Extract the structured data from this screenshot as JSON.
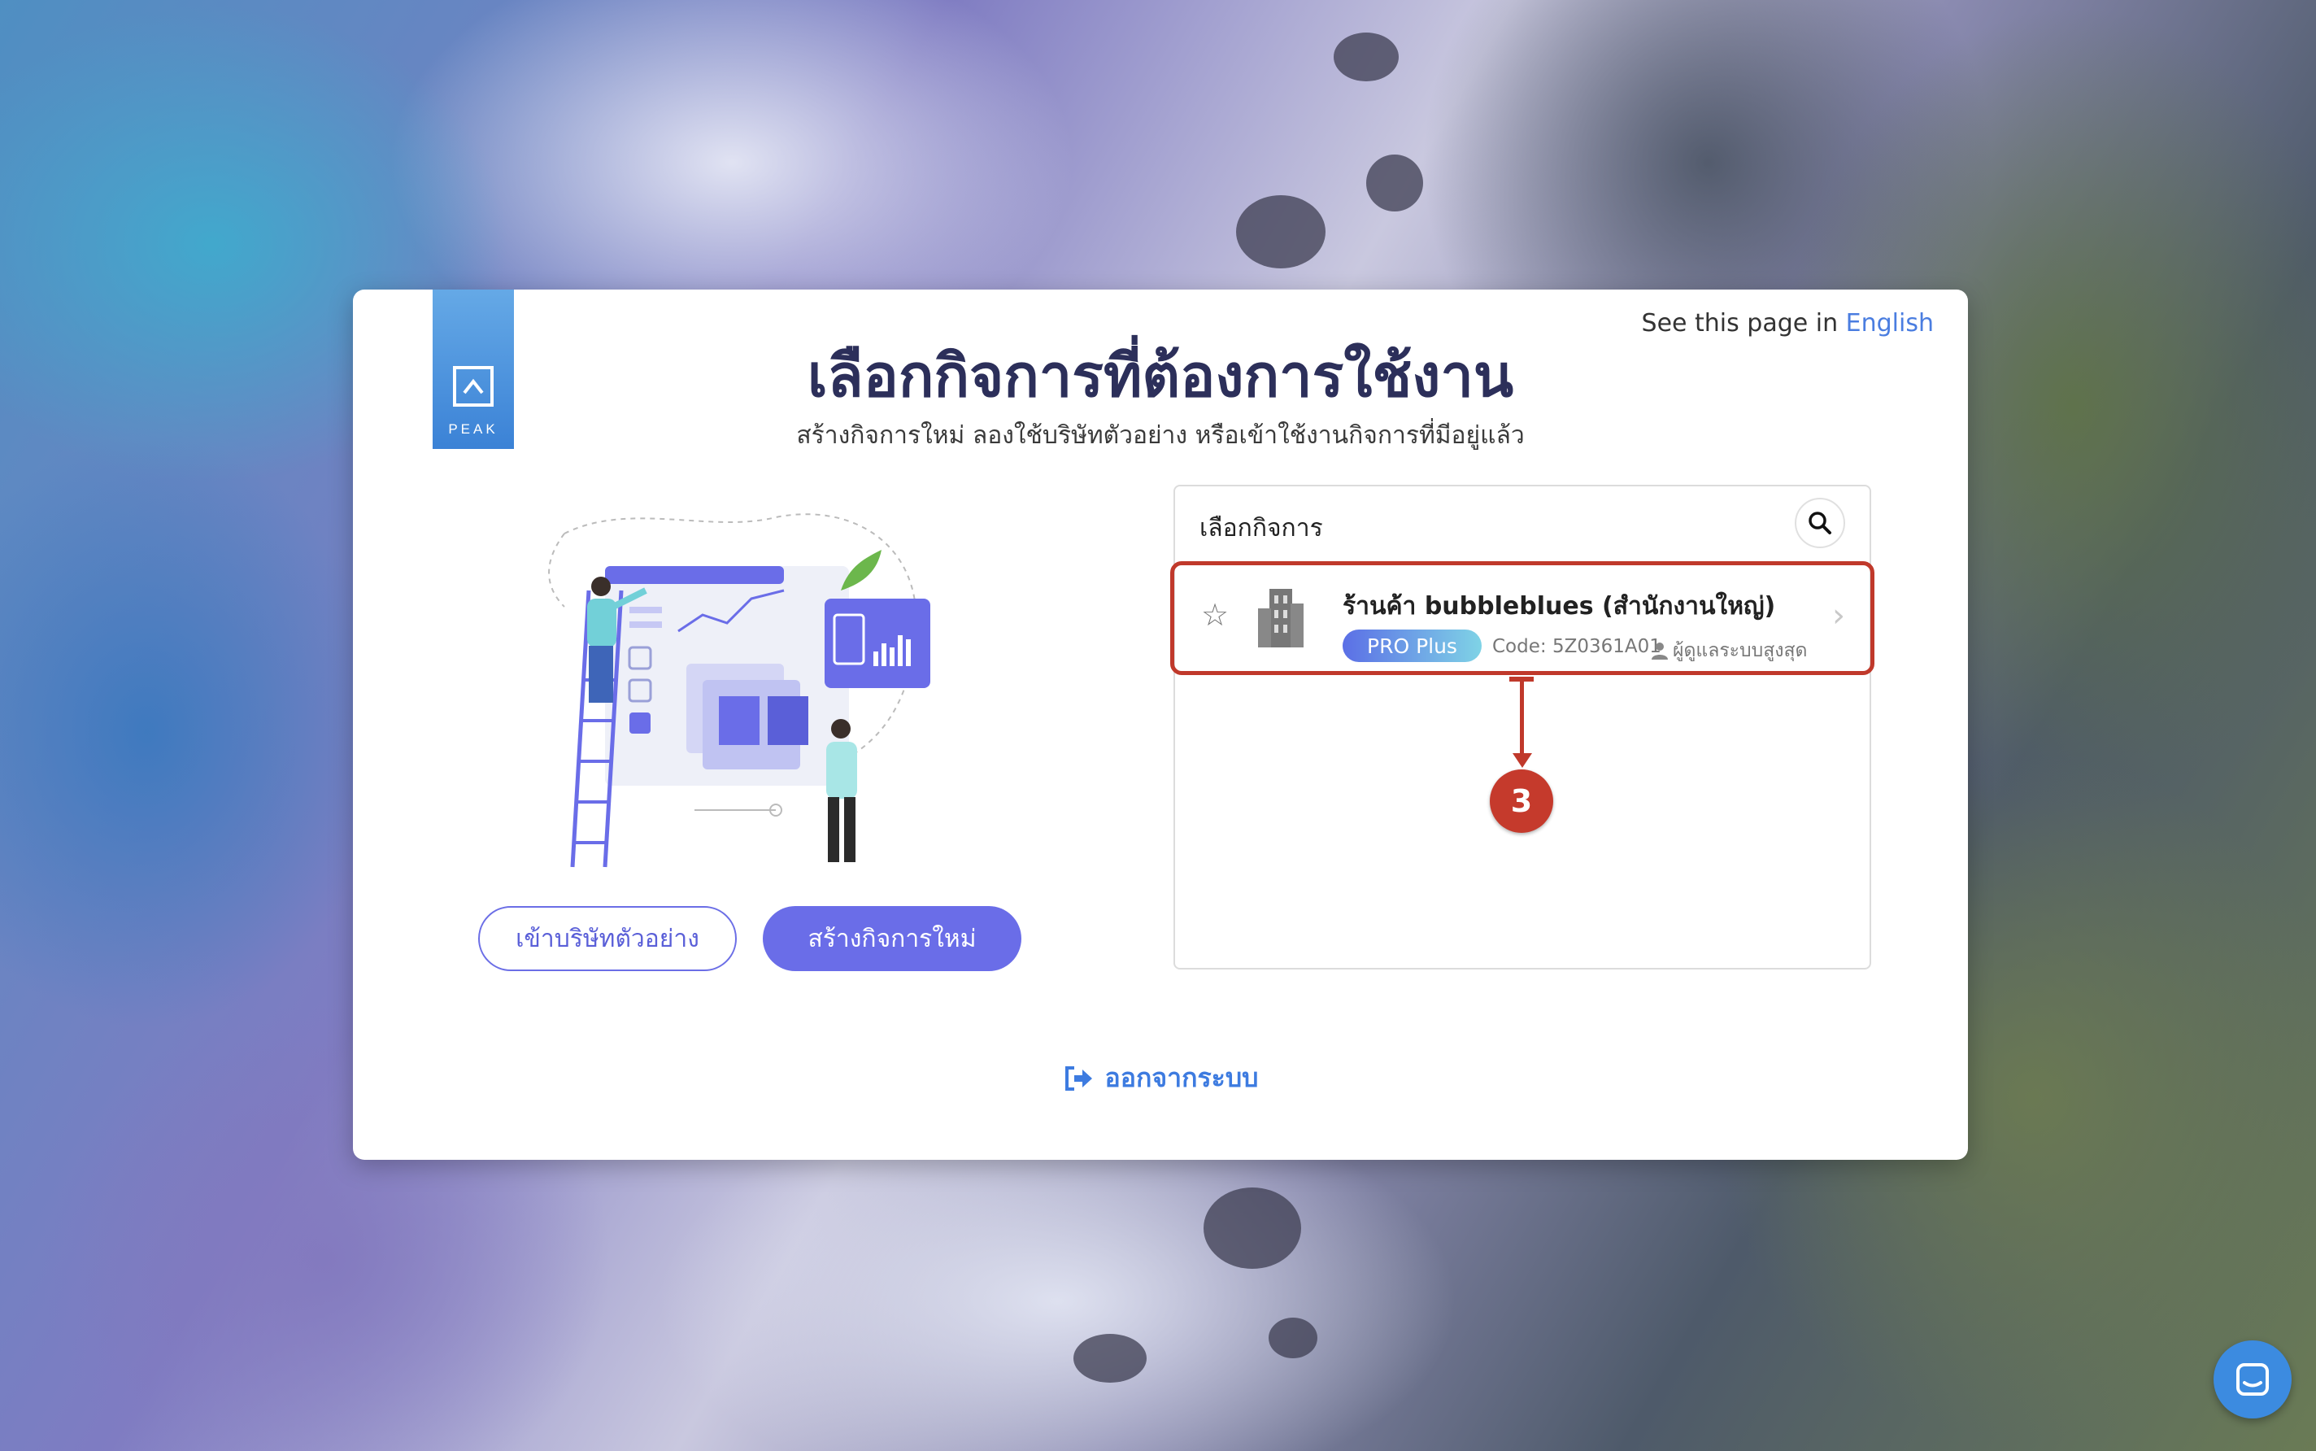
{
  "language": {
    "prefix": "See this page in",
    "link": "English"
  },
  "logo": {
    "text": "PEAK"
  },
  "page": {
    "title": "เลือกกิจการที่ต้องการใช้งาน",
    "subtitle": "สร้างกิจการใหม่ ลองใช้บริษัทตัวอย่าง หรือเข้าใช้งานกิจการที่มีอยู่แล้ว"
  },
  "actions": {
    "demo_label": "เข้าบริษัทตัวอย่าง",
    "create_label": "สร้างกิจการใหม่"
  },
  "business_panel": {
    "header": "เลือกกิจการ",
    "items": [
      {
        "name": "ร้านค้า bubbleblues (สำนักงานใหญ่)",
        "plan": "PRO Plus",
        "code": "Code: 5Z0361A01",
        "role": "ผู้ดูแลระบบสูงสุด"
      }
    ]
  },
  "annotation": {
    "step": "3",
    "color": "#c0392b"
  },
  "logout": {
    "label": "ออกจากระบบ"
  },
  "colors": {
    "accent": "#6a6de8",
    "link": "#3d7be0",
    "title": "#2c2f5a"
  }
}
